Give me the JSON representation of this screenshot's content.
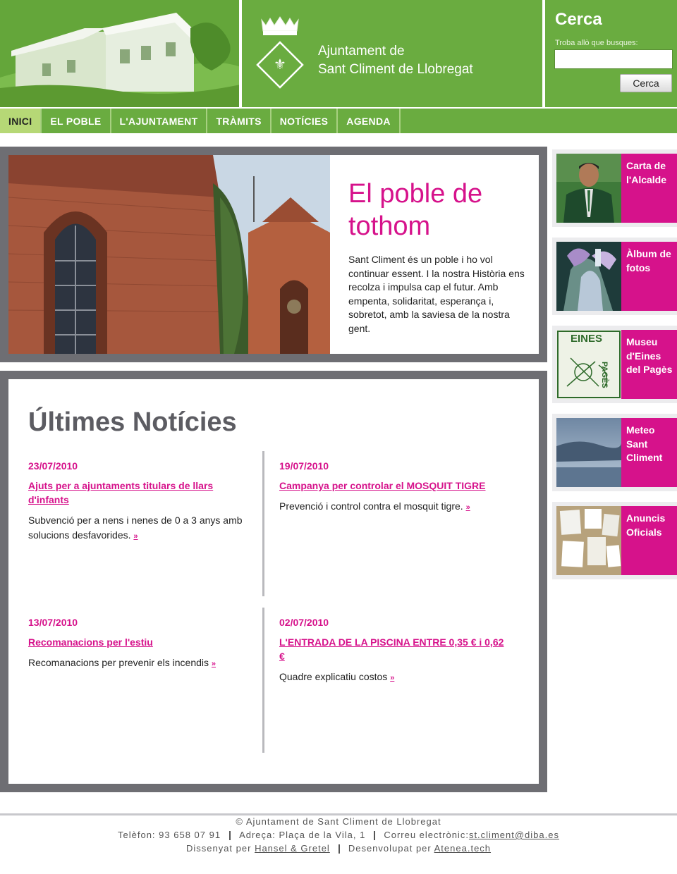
{
  "header": {
    "org_line1": "Ajuntament de",
    "org_line2": "Sant Climent de Llobregat"
  },
  "search": {
    "title": "Cerca",
    "hint": "Troba allò que busques:",
    "input_value": "",
    "button_label": "Cerca"
  },
  "nav": {
    "items": [
      {
        "label": "INICI"
      },
      {
        "label": "EL POBLE"
      },
      {
        "label": "L'AJUNTAMENT"
      },
      {
        "label": "TRÀMITS"
      },
      {
        "label": "NOTÍCIES"
      },
      {
        "label": "AGENDA"
      }
    ],
    "active_index": 0
  },
  "hero": {
    "title": "El poble de tothom",
    "text": "Sant Climent és un poble i ho vol continuar essent. I la nostra Història ens recolza i impulsa cap el futur. Amb empenta, solidaritat, esperança i, sobretot, amb la saviesa de la nostra gent."
  },
  "news": {
    "title": "Últimes Notícies",
    "more_symbol": "»",
    "items": [
      {
        "date": "23/07/2010",
        "title": "Ajuts per a ajuntaments titulars de llars d'infants",
        "summary": "Subvenció per a nens i nenes de 0 a 3 anys amb solucions desfavorides."
      },
      {
        "date": "19/07/2010",
        "title": "Campanya per controlar el MOSQUIT TIGRE",
        "summary": "Prevenció i control contra el mosquit tigre."
      },
      {
        "date": "13/07/2010",
        "title": "Recomanacions per l'estiu",
        "summary": "Recomanacions per prevenir els incendis"
      },
      {
        "date": "02/07/2010",
        "title": "L'ENTRADA DE LA PISCINA ENTRE 0,35 € i 0,62 €",
        "summary": "Quadre explicatiu costos"
      }
    ]
  },
  "sidebar": {
    "items": [
      {
        "label": "Carta de l'Alcalde"
      },
      {
        "label": "Àlbum de fotos"
      },
      {
        "label": "Museu d'Eines del Pagès"
      },
      {
        "label": "Meteo Sant Climent"
      },
      {
        "label": "Anuncis Oficials"
      }
    ],
    "museum_image_text": "EINES",
    "museum_image_text2": "PAGÈS"
  },
  "footer": {
    "copyright": "© Ajuntament de Sant Climent de Llobregat",
    "phone": "Telèfon: 93 658 07 91",
    "address": "Adreça: Plaça de la Vila, 1",
    "email_label": "Correu electrònic:",
    "email": "st.climent@diba.es",
    "designed_label": "Dissenyat per",
    "designer": "Hansel & Gretel",
    "developed_label": "Desenvolupat per",
    "developer": "Atenea.tech"
  },
  "colors": {
    "green": "#6aac40",
    "magenta": "#d6128b",
    "frame_gray": "#6e6e73"
  }
}
